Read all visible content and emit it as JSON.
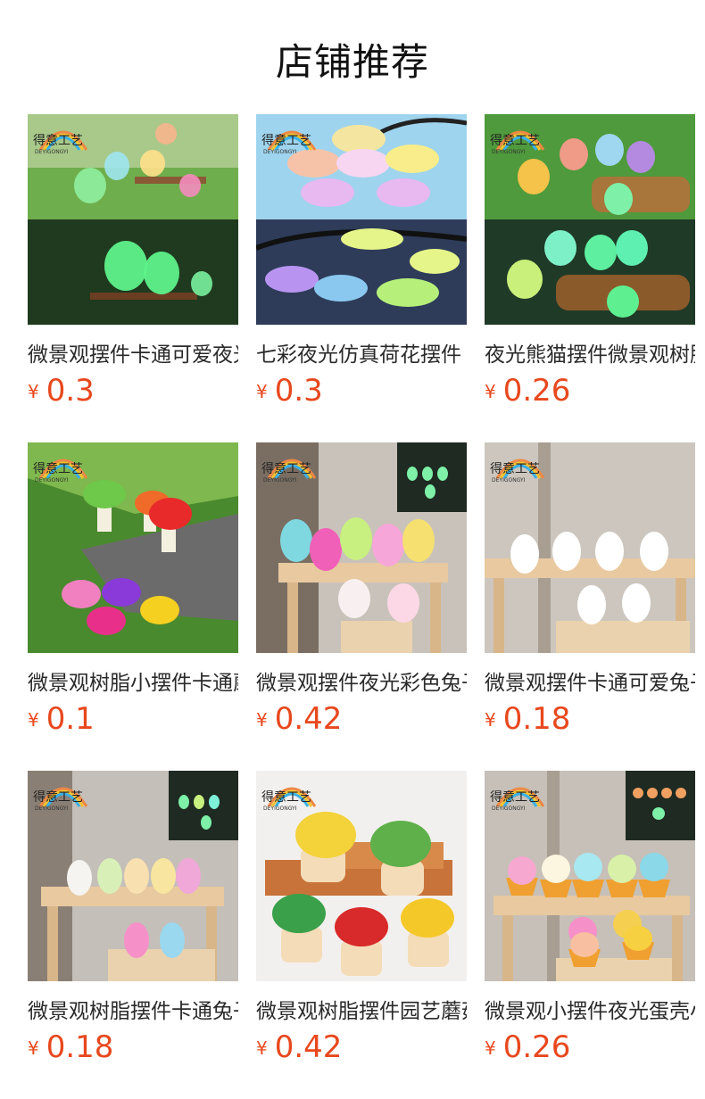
{
  "header": {
    "title": "店铺推荐"
  },
  "brand": {
    "logo_text": "得意工艺",
    "logo_sub": "DEYIGONGYI"
  },
  "currency_symbol": "¥",
  "accent_color": "#e8481e",
  "products": [
    {
      "name": "微景观摆件卡通可爱夜光",
      "price": "0.3",
      "image": "glow-rabbit-figurines"
    },
    {
      "name": "七彩夜光仿真荷花摆件",
      "price": "0.3",
      "image": "glow-lotus-flowers"
    },
    {
      "name": "夜光熊猫摆件微景观树脂",
      "price": "0.26",
      "image": "glow-panda-figurines"
    },
    {
      "name": "微景观树脂小摆件卡通蘑菇",
      "price": "0.1",
      "image": "resin-mushrooms"
    },
    {
      "name": "微景观摆件夜光彩色兔子",
      "price": "0.42",
      "image": "colorful-bunnies"
    },
    {
      "name": "微景观摆件卡通可爱兔子",
      "price": "0.18",
      "image": "white-rabbits"
    },
    {
      "name": "微景观树脂摆件卡通兔子",
      "price": "0.18",
      "image": "pastel-rabbits"
    },
    {
      "name": "微景观树脂摆件园艺蘑菇屋",
      "price": "0.42",
      "image": "mushroom-houses"
    },
    {
      "name": "微景观小摆件夜光蛋壳小鸡",
      "price": "0.26",
      "image": "eggshell-chicks"
    }
  ]
}
